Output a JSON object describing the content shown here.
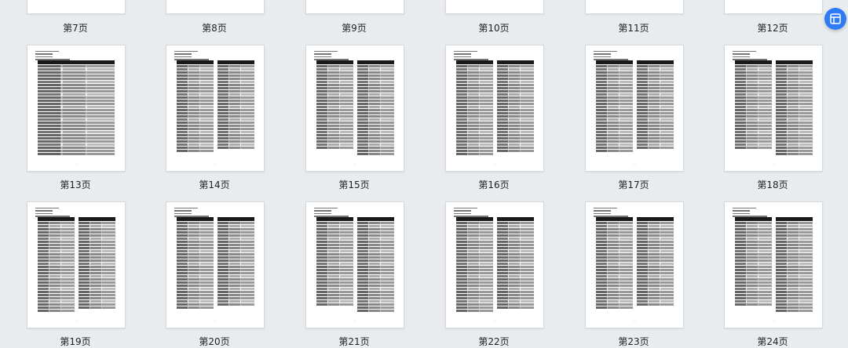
{
  "page_labels": [
    "第7页",
    "第8页",
    "第9页",
    "第10页",
    "第11页",
    "第12页",
    "第13页",
    "第14页",
    "第15页",
    "第16页",
    "第17页",
    "第18页",
    "第19页",
    "第20页",
    "第21页",
    "第22页",
    "第23页",
    "第24页"
  ],
  "floating_button_icon": "page-thumbnail-icon",
  "accent_color": "#2f7bf5"
}
